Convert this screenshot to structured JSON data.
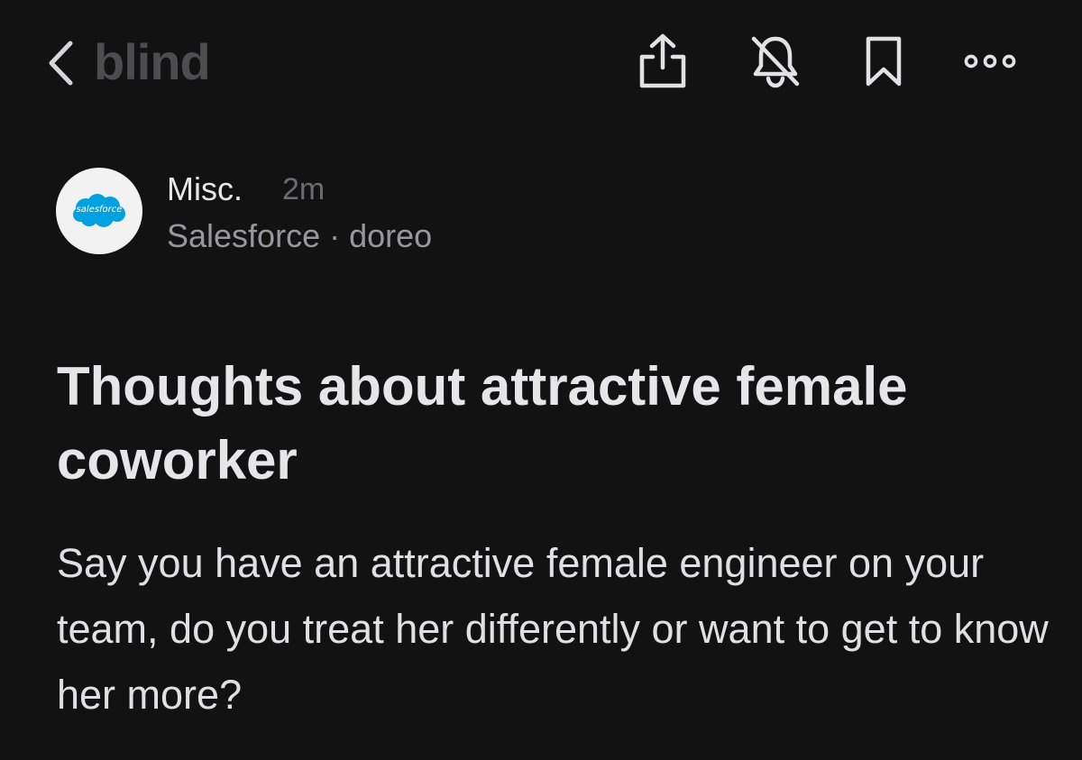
{
  "header": {
    "app_name": "blind",
    "icons": {
      "back": "chevron-left-icon",
      "share": "share-icon",
      "notifications": "bell-off-icon",
      "bookmark": "bookmark-icon",
      "more": "more-horizontal-icon"
    }
  },
  "post": {
    "channel": "Misc.",
    "time": "2m",
    "company_line": "Salesforce · doreo",
    "avatar_logo_text": "salesforce",
    "title": "Thoughts about attractive female coworker",
    "body": "Say you have an attractive female engineer on your team, do you treat her differently or want to get to know her more?"
  },
  "colors": {
    "background": "#121212",
    "logo_gray": "#4d4d50",
    "salesforce_blue": "#00a1e0",
    "text_primary": "#e6e6e8",
    "text_secondary": "#98989c"
  }
}
